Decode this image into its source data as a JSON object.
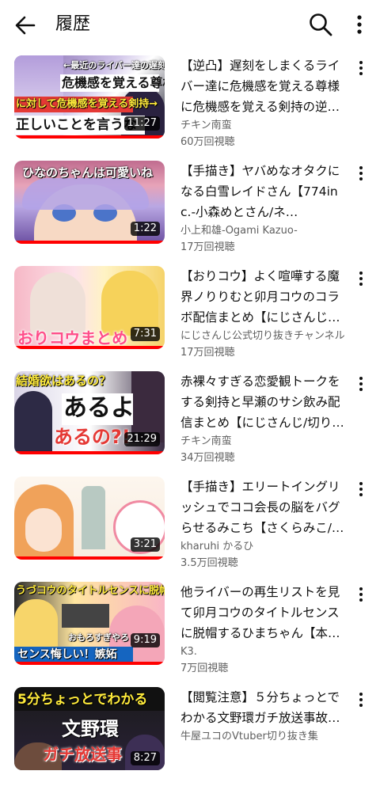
{
  "header": {
    "title": "履歴"
  },
  "colors": {
    "accent": "#ff0000",
    "secondary_text": "#606060"
  },
  "videos": [
    {
      "title": "【逆凸】遅刻をしまくるライバー達に危機感を覚える尊様に危機感を覚える剣持の逆…",
      "channel": "チキン南蛮",
      "views": "60万回視聴",
      "duration": "11:27",
      "progress": 1.0,
      "thumb_text": [
        "←最近のライバー達の遅刻問題に",
        "危機感を覚える尊様",
        "に対して危機感を覚える剣持→",
        "正しいことを言うな"
      ]
    },
    {
      "title": "【手描き】ヤバめなオタクになる白雪レイドさん【774inc.-小森めとさん/ネ…",
      "channel": "小上和雄-Ogami Kazuo-",
      "views": "17万回視聴",
      "duration": "1:22",
      "progress": 1.0,
      "thumb_text": [
        "ひなのちゃんは可愛いね"
      ]
    },
    {
      "title": "【おりコウ】よく喧嘩する魔界ノりりむと卯月コウのコラボ配信まとめ【にじさんじ…",
      "channel": "にじさんじ公式切り抜きチャンネル",
      "views": "17万回視聴",
      "duration": "7:31",
      "progress": 1.0,
      "thumb_text": [
        "おりコウまとめ"
      ]
    },
    {
      "title": "赤裸々すぎる恋愛観トークをする剣持と早瀬のサシ飲み配信まとめ【にじさんじ/切り…",
      "channel": "チキン南蛮",
      "views": "34万回視聴",
      "duration": "21:29",
      "progress": 1.0,
      "thumb_text": [
        "結婚欲はあるの？",
        "あるよ",
        "あるの?!"
      ]
    },
    {
      "title": "【手描き】エリートイングリッシュでココ会長の脳をバグらせるみこち【さくらみこ/…",
      "channel": "kharuhi かるひ",
      "views": "3.5万回視聴",
      "duration": "3:21",
      "progress": 1.0,
      "thumb_text": []
    },
    {
      "title": "他ライバーの再生リストを見て卯月コウのタイトルセンスに脱帽するひまちゃん【本…",
      "channel": "K3.",
      "views": "7万回視聴",
      "duration": "9:19",
      "progress": 1.0,
      "thumb_text": [
        "うづコウのタイトルセンスに脱帽",
        "おもろすぎやろ",
        "センス悔しい！嫉妬"
      ]
    },
    {
      "title": "【閲覧注意】５分ちょっとでわかる文野環ガチ放送事故【にじさんじ/文野環/剣持…",
      "channel": "牛屋ユコのVtuber切り抜き集",
      "views": "",
      "duration": "8:27",
      "progress": 1.0,
      "thumb_text": [
        "5分ちょっとでわかる",
        "文野環",
        "ガチ放送事"
      ]
    }
  ]
}
